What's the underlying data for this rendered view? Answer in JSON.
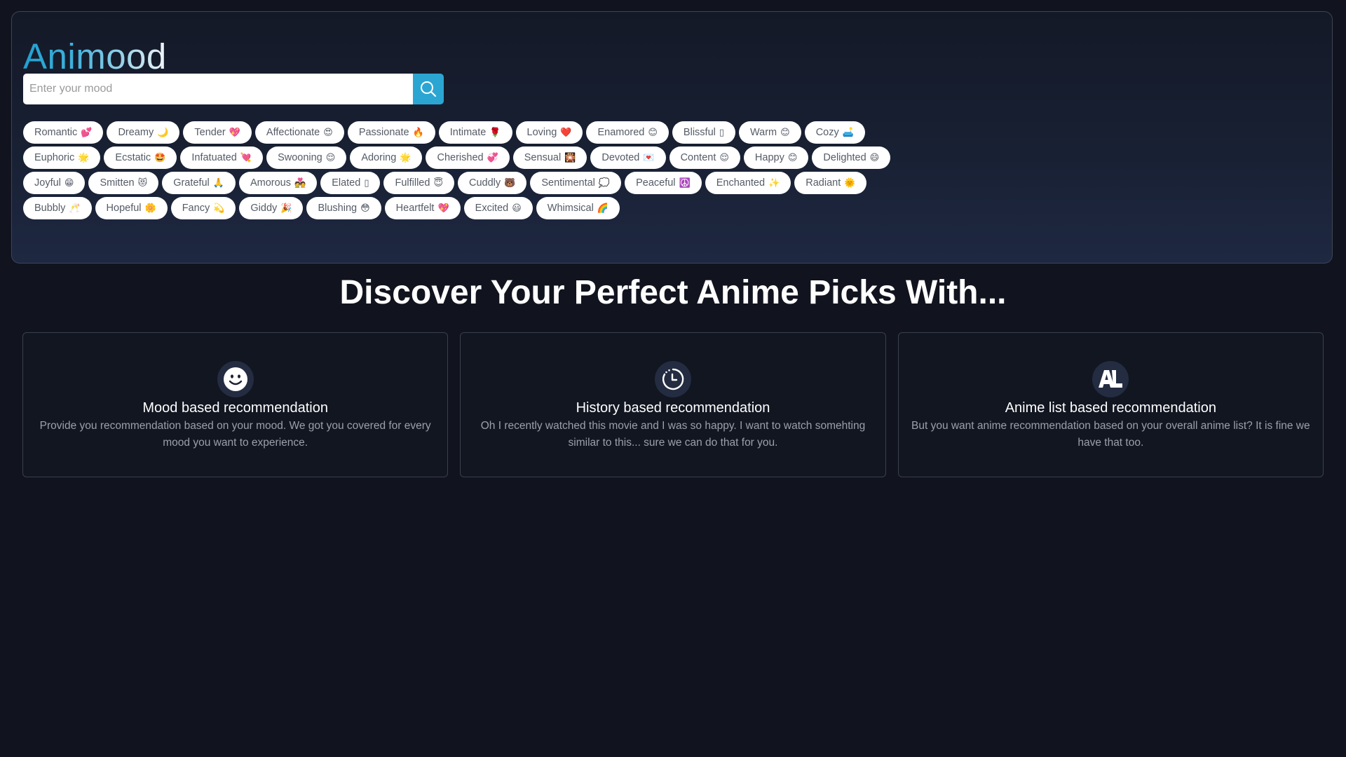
{
  "header": {
    "brand": "Animood",
    "search": {
      "placeholder": "Enter your mood",
      "value": "",
      "button_icon": "search-icon"
    }
  },
  "moods": [
    {
      "label": "Romantic",
      "emoji": "💕"
    },
    {
      "label": "Dreamy",
      "emoji": "🌙"
    },
    {
      "label": "Tender",
      "emoji": "💖"
    },
    {
      "label": "Affectionate",
      "emoji": "😍"
    },
    {
      "label": "Passionate",
      "emoji": "🔥"
    },
    {
      "label": "Intimate",
      "emoji": "🌹"
    },
    {
      "label": "Loving",
      "emoji": "❤️"
    },
    {
      "label": "Enamored",
      "emoji": "😊"
    },
    {
      "label": "Blissful",
      "emoji": "▯"
    },
    {
      "label": "Warm",
      "emoji": "😊"
    },
    {
      "label": "Cozy",
      "emoji": "🛋️"
    },
    {
      "label": "Euphoric",
      "emoji": "🌟"
    },
    {
      "label": "Ecstatic",
      "emoji": "🤩"
    },
    {
      "label": "Infatuated",
      "emoji": "💘"
    },
    {
      "label": "Swooning",
      "emoji": "😌"
    },
    {
      "label": "Adoring",
      "emoji": "🌟"
    },
    {
      "label": "Cherished",
      "emoji": "💞"
    },
    {
      "label": "Sensual",
      "emoji": "🎇"
    },
    {
      "label": "Devoted",
      "emoji": "💌"
    },
    {
      "label": "Content",
      "emoji": "😌"
    },
    {
      "label": "Happy",
      "emoji": "😊"
    },
    {
      "label": "Delighted",
      "emoji": "😄"
    },
    {
      "label": "Joyful",
      "emoji": "😁"
    },
    {
      "label": "Smitten",
      "emoji": "😻"
    },
    {
      "label": "Grateful",
      "emoji": "🙏"
    },
    {
      "label": "Amorous",
      "emoji": "💑"
    },
    {
      "label": "Elated",
      "emoji": "▯"
    },
    {
      "label": "Fulfilled",
      "emoji": "😇"
    },
    {
      "label": "Cuddly",
      "emoji": "🐻"
    },
    {
      "label": "Sentimental",
      "emoji": "💭"
    },
    {
      "label": "Peaceful",
      "emoji": "☮️"
    },
    {
      "label": "Enchanted",
      "emoji": "✨"
    },
    {
      "label": "Radiant",
      "emoji": "🌞"
    },
    {
      "label": "Bubbly",
      "emoji": "🥂"
    },
    {
      "label": "Hopeful",
      "emoji": "🌼"
    },
    {
      "label": "Fancy",
      "emoji": "💫"
    },
    {
      "label": "Giddy",
      "emoji": "🎉"
    },
    {
      "label": "Blushing",
      "emoji": "😳"
    },
    {
      "label": "Heartfelt",
      "emoji": "💖"
    },
    {
      "label": "Excited",
      "emoji": "😃"
    },
    {
      "label": "Whimsical",
      "emoji": "🌈"
    }
  ],
  "main": {
    "headline": "Discover Your Perfect Anime Picks With...",
    "cards": [
      {
        "icon": "smiley-face-icon",
        "title": "Mood based recommendation",
        "description": "Provide you recommendation based on your mood. We got you covered for every mood you want to experience."
      },
      {
        "icon": "history-clock-icon",
        "title": "History based recommendation",
        "description": "Oh I recently watched this movie and I was so happy. I want to watch somehting similar to this... sure we can do that for you."
      },
      {
        "icon": "anilist-logo-icon",
        "icon_text": "AL",
        "title": "Anime list based recommendation",
        "description": "But you want anime recommendation based on your overall anime list? It is fine we have that too."
      }
    ]
  },
  "colors": {
    "accent": "#2ba6d3",
    "background": "#11141f",
    "chip_bg": "#ffffff",
    "chip_text": "#555b66",
    "card_border": "#3a3f4d",
    "icon_circle": "#242c41"
  }
}
